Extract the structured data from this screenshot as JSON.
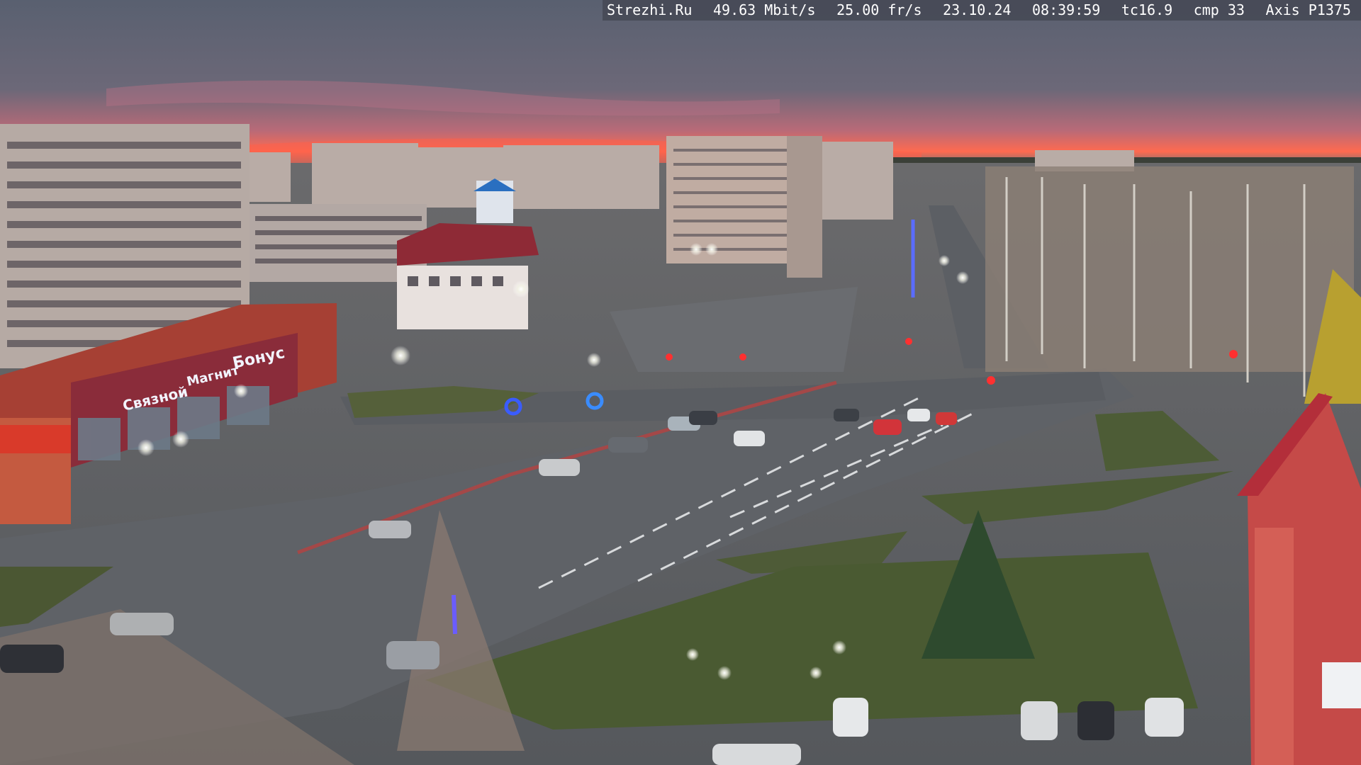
{
  "overlay": {
    "site": "Strezhi.Ru",
    "bitrate": "49.63 Mbit/s",
    "framerate": "25.00 fr/s",
    "date": "23.10.24",
    "time": "08:39:59",
    "tc": "tc16.9",
    "cmp": "cmp 33",
    "camera": "Axis P1375"
  },
  "signs": {
    "store_main": "Бонус",
    "store_mid": "Магнит",
    "store_left": "Связной"
  },
  "colors": {
    "sky_top": "#5b6070",
    "sunrise": "#ff6a55",
    "road": "#5d6066",
    "grass": "#4a5a34",
    "brick": "#b84a3a"
  }
}
